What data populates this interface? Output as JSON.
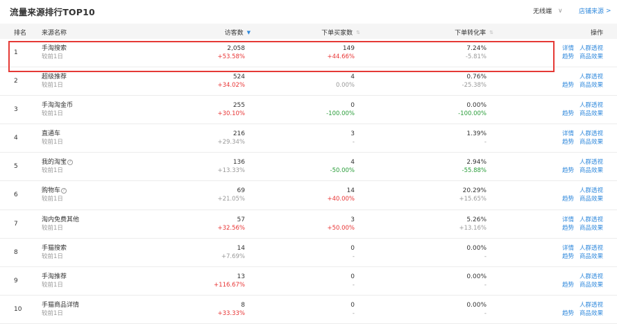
{
  "header": {
    "title": "流量来源排行TOP10",
    "device_select": "无线端",
    "store_link": "店铺来源"
  },
  "columns": {
    "rank": "排名",
    "source": "来源名称",
    "visitors": "访客数",
    "buyers": "下单买家数",
    "conversion": "下单转化率",
    "actions": "操作"
  },
  "actions": {
    "detail": "详情",
    "crowd": "人群透视",
    "trend": "趋势",
    "effect": "商品效果"
  },
  "rows": [
    {
      "rank": "1",
      "name": "手淘搜索",
      "sub": "较前1日",
      "visitors": "2,058",
      "visitors_change": "+53.58%",
      "buyers": "149",
      "buyers_change": "+44.66%",
      "conv": "7.24%",
      "conv_change": "-5.81%"
    },
    {
      "rank": "2",
      "name": "超级推荐",
      "sub": "较前1日",
      "visitors": "524",
      "visitors_change": "+34.02%",
      "buyers": "4",
      "buyers_change": "0.00%",
      "conv": "0.76%",
      "conv_change": "-25.38%"
    },
    {
      "rank": "3",
      "name": "手淘淘金币",
      "sub": "较前1日",
      "visitors": "255",
      "visitors_change": "+30.10%",
      "buyers": "0",
      "buyers_change": "-100.00%",
      "conv": "0.00%",
      "conv_change": "-100.00%"
    },
    {
      "rank": "4",
      "name": "直通车",
      "sub": "较前1日",
      "visitors": "216",
      "visitors_change": "+29.34%",
      "buyers": "3",
      "buyers_change": "-",
      "conv": "1.39%",
      "conv_change": "-"
    },
    {
      "rank": "5",
      "name": "我的淘宝",
      "sub": "较前1日",
      "visitors": "136",
      "visitors_change": "+13.33%",
      "buyers": "4",
      "buyers_change": "-50.00%",
      "conv": "2.94%",
      "conv_change": "-55.88%"
    },
    {
      "rank": "6",
      "name": "购物车",
      "sub": "较前1日",
      "visitors": "69",
      "visitors_change": "+21.05%",
      "buyers": "14",
      "buyers_change": "+40.00%",
      "conv": "20.29%",
      "conv_change": "+15.65%"
    },
    {
      "rank": "7",
      "name": "淘内免费其他",
      "sub": "较前1日",
      "visitors": "57",
      "visitors_change": "+32.56%",
      "buyers": "3",
      "buyers_change": "+50.00%",
      "conv": "5.26%",
      "conv_change": "+13.16%"
    },
    {
      "rank": "8",
      "name": "手猫搜索",
      "sub": "较前1日",
      "visitors": "14",
      "visitors_change": "+7.69%",
      "buyers": "0",
      "buyers_change": "-",
      "conv": "0.00%",
      "conv_change": "-"
    },
    {
      "rank": "9",
      "name": "手淘推荐",
      "sub": "较前1日",
      "visitors": "13",
      "visitors_change": "+116.67%",
      "buyers": "0",
      "buyers_change": "-",
      "conv": "0.00%",
      "conv_change": "-"
    },
    {
      "rank": "10",
      "name": "手猫商品详情",
      "sub": "较前1日",
      "visitors": "8",
      "visitors_change": "+33.33%",
      "buyers": "0",
      "buyers_change": "-",
      "conv": "0.00%",
      "conv_change": "-"
    }
  ]
}
